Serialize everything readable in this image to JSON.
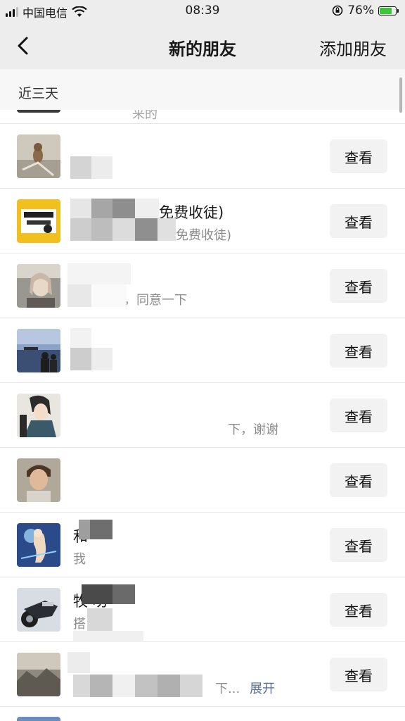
{
  "status_bar": {
    "carrier": "中国电信",
    "time": "08:39",
    "battery_percent": "76%",
    "battery_level": 0.76,
    "battery_color": "#3cc63c"
  },
  "nav": {
    "title": "新的朋友",
    "action": "添加朋友",
    "back_icon": "chevron-left-icon"
  },
  "section": {
    "header": "近三天"
  },
  "partial_row": {
    "message": "来的"
  },
  "rows": [
    {
      "name": "",
      "message": "",
      "button": "查看",
      "avatar": "cat-photo"
    },
    {
      "name": "免费收徒)",
      "message": "免费收徒)",
      "button": "查看",
      "avatar": "cartoon-poster"
    },
    {
      "name": "",
      "message": "，同意一下",
      "button": "查看",
      "avatar": "girl-photo"
    },
    {
      "name": "",
      "message": "",
      "button": "查看",
      "avatar": "seaside-couple"
    },
    {
      "name": "",
      "message": "下，谢谢",
      "button": "查看",
      "avatar": "anime-boy"
    },
    {
      "name": "",
      "message": "",
      "button": "查看",
      "avatar": "boy-photo"
    },
    {
      "name": "和",
      "message": "我",
      "button": "查看",
      "avatar": "glowing-cat"
    },
    {
      "name": "牧  功",
      "message": "搭",
      "button": "查看",
      "avatar": "motorcycle"
    },
    {
      "name": "",
      "message": "下...",
      "expand": "展开",
      "button": "查看",
      "avatar": "mountain"
    }
  ]
}
